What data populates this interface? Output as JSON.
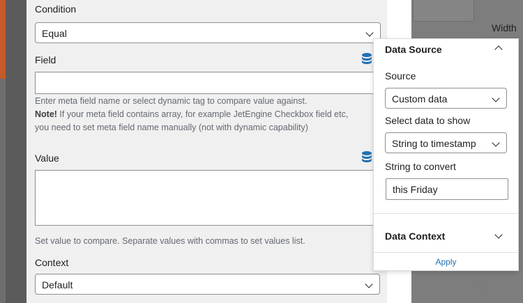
{
  "background": {
    "width_label": "Width"
  },
  "form": {
    "condition": {
      "label": "Condition",
      "value": "Equal"
    },
    "field": {
      "label": "Field",
      "value": "",
      "help_line1": "Enter meta field name or select dynamic tag to compare value against.",
      "note_bold": "Note!",
      "help_line2": " If your meta field contains array, for example JetEngine Checkbox field etc,",
      "help_line3": "you need to set meta field name manually (not with dynamic capability)"
    },
    "value": {
      "label": "Value",
      "value": "",
      "help": "Set value to compare. Separate values with commas to set values list."
    },
    "context": {
      "label": "Context",
      "value": "Default"
    }
  },
  "popover": {
    "data_source": {
      "title": "Data Source",
      "source_label": "Source",
      "source_value": "Custom data",
      "select_label": "Select data to show",
      "select_value": "String to timestamp",
      "string_label": "String to convert",
      "string_value": "this Friday"
    },
    "data_context": {
      "title": "Data Context"
    },
    "apply_label": "Apply"
  },
  "colors": {
    "accent": "#2271b1",
    "db_icon": "#2271b1"
  }
}
